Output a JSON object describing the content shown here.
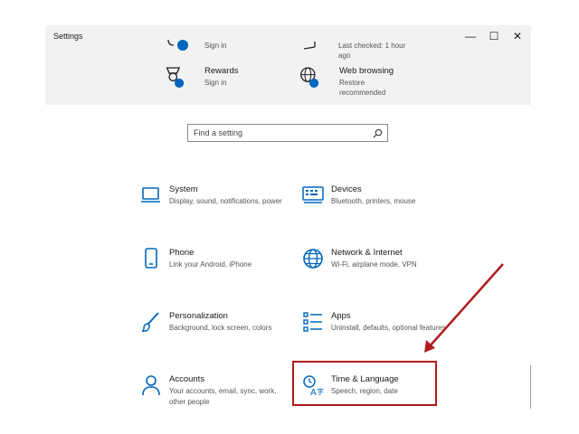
{
  "window": {
    "title": "Settings",
    "controls": {
      "minimize": "—",
      "maximize": "☐",
      "close": "✕"
    }
  },
  "promos": [
    {
      "id": "partial-left",
      "subtitle": "Sign in"
    },
    {
      "id": "partial-right",
      "subtitle_lines": [
        "Last checked: 1 hour",
        "ago"
      ]
    },
    {
      "id": "rewards",
      "title": "Rewards",
      "subtitle": "Sign in"
    },
    {
      "id": "web-browsing",
      "title": "Web browsing",
      "subtitle_lines": [
        "Restore",
        "recommended"
      ]
    }
  ],
  "search": {
    "placeholder": "Find a setting"
  },
  "tiles": [
    {
      "icon": "laptop-icon",
      "title": "System",
      "desc": "Display, sound, notifications, power"
    },
    {
      "icon": "keyboard-devices-icon",
      "title": "Devices",
      "desc": "Bluetooth, printers, mouse"
    },
    {
      "icon": "phone-icon",
      "title": "Phone",
      "desc": "Link your Android, iPhone"
    },
    {
      "icon": "globe-icon",
      "title": "Network & Internet",
      "desc": "Wi-Fi, airplane mode, VPN"
    },
    {
      "icon": "brush-icon",
      "title": "Personalization",
      "desc": "Background, lock screen, colors"
    },
    {
      "icon": "apps-list-icon",
      "title": "Apps",
      "desc": "Uninstall, defaults, optional features"
    },
    {
      "icon": "person-icon",
      "title": "Accounts",
      "desc": "Your accounts, email, sync, work, other people"
    },
    {
      "icon": "time-language-icon",
      "title": "Time & Language",
      "desc": "Speech, region, date"
    }
  ],
  "colors": {
    "accent": "#0067c0",
    "annotation": "#b01c1c",
    "banner": "#f2f2f2"
  }
}
